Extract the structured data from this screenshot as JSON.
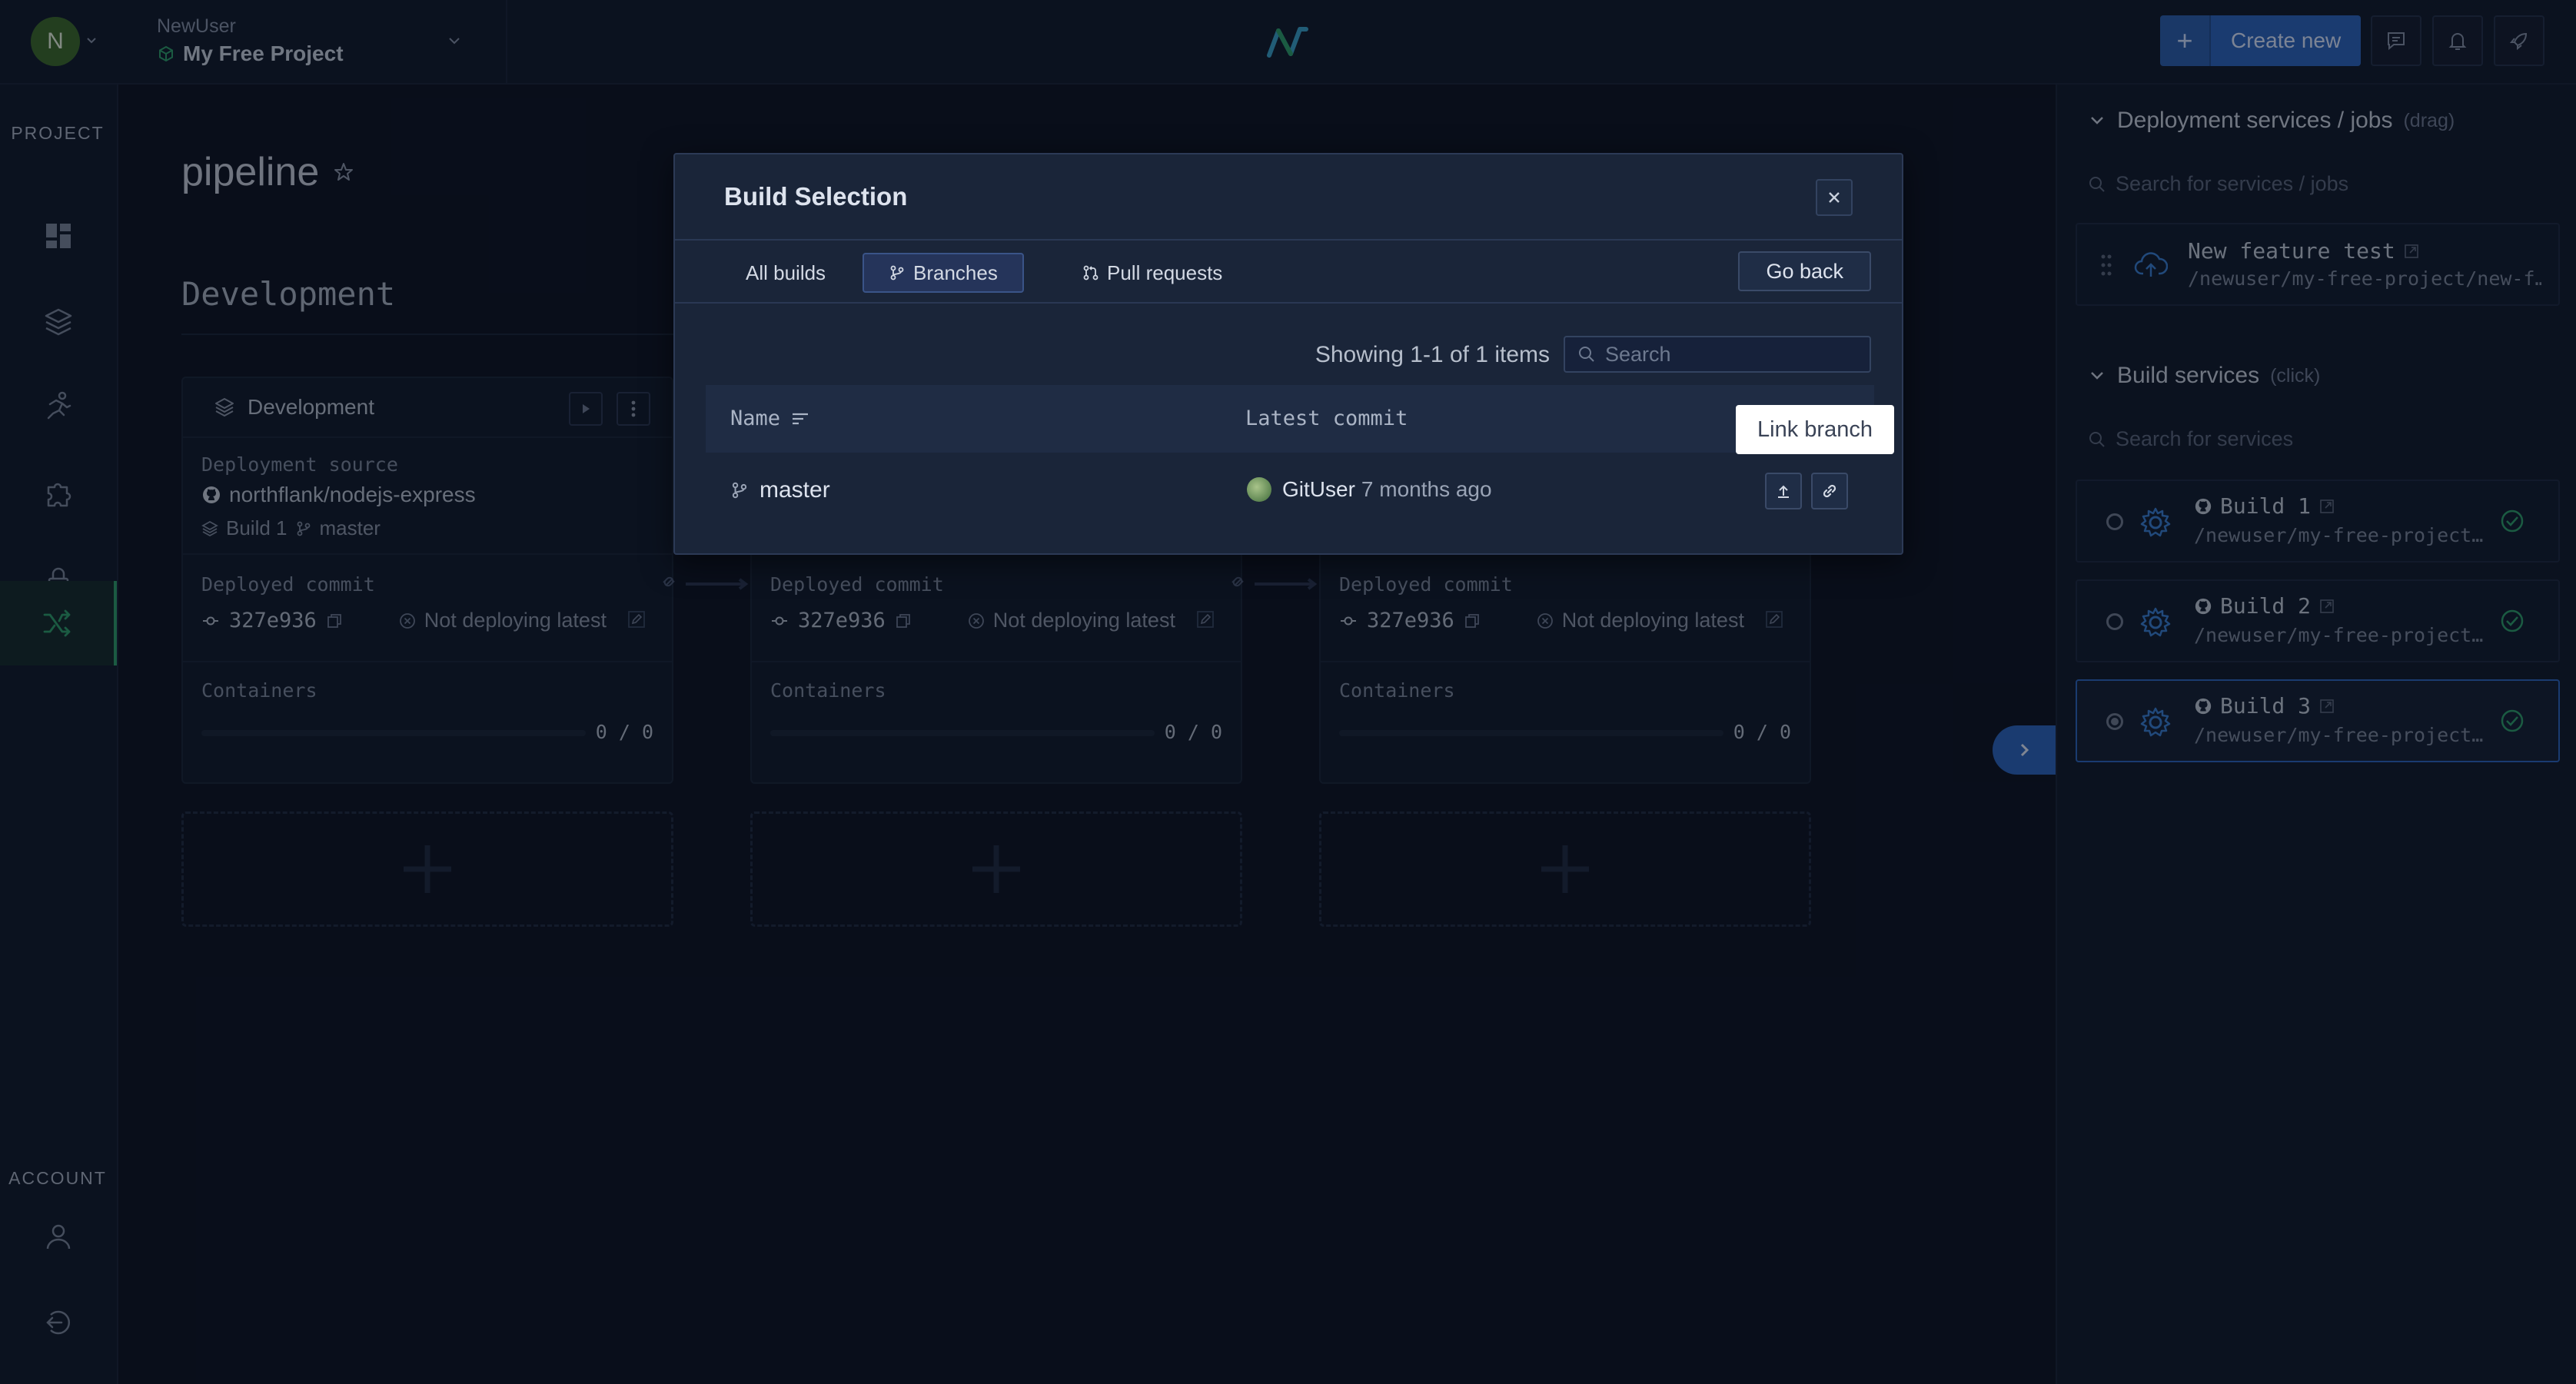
{
  "topbar": {
    "avatar_initial": "N",
    "project_user": "NewUser",
    "project_name": "My Free Project",
    "create_label": "Create new",
    "create_plus": "+"
  },
  "leftnav": {
    "project_heading": "PROJECT",
    "account_heading": "ACCOUNT",
    "items": [
      "dashboard-icon",
      "layers-icon",
      "runner-icon",
      "puzzle-icon",
      "lock-icon",
      "pipeline-icon"
    ],
    "active_item": "pipeline-icon"
  },
  "page": {
    "title": "pipeline",
    "stage_title": "Development"
  },
  "cards": [
    {
      "header": "Development",
      "source_label": "Deployment source",
      "repo": "northflank/nodejs-express",
      "build": "Build 1",
      "branch": "master",
      "commit_label": "Deployed commit",
      "commit": "327e936",
      "status": "Not deploying latest",
      "containers_label": "Containers",
      "containers_count": "0 / 0"
    },
    {
      "commit_label": "Deployed commit",
      "commit": "327e936",
      "status": "Not deploying latest",
      "containers_label": "Containers",
      "containers_count": "0 / 0"
    },
    {
      "commit_label": "Deployed commit",
      "commit": "327e936",
      "status": "Not deploying latest",
      "containers_label": "Containers",
      "containers_count": "0 / 0"
    }
  ],
  "rpanel": {
    "deploy_title": "Deployment services / jobs",
    "deploy_hint": "(drag)",
    "deploy_search_placeholder": "Search for services / jobs",
    "deploy_items": [
      {
        "name": "New feature test",
        "path": "/newuser/my-free-project/new-f…"
      }
    ],
    "build_title": "Build services",
    "build_hint": "(click)",
    "build_search_placeholder": "Search for services",
    "build_items": [
      {
        "name": "Build 1",
        "path": "/newuser/my-free-project…",
        "selected": false
      },
      {
        "name": "Build 2",
        "path": "/newuser/my-free-project…",
        "selected": false
      },
      {
        "name": "Build 3",
        "path": "/newuser/my-free-project…",
        "selected": true
      }
    ]
  },
  "modal": {
    "title": "Build Selection",
    "tabs": [
      "All builds",
      "Branches",
      "Pull requests"
    ],
    "active_tab": "Branches",
    "go_back": "Go back",
    "showing": "Showing 1-1 of 1 items",
    "search_placeholder": "Search",
    "columns": {
      "name": "Name",
      "latest_commit": "Latest commit"
    },
    "rows": [
      {
        "name": "master",
        "commit_user": "GitUser",
        "commit_age": "7 months ago"
      }
    ],
    "tooltip": "Link branch"
  },
  "colors": {
    "accent": "#2c65bd",
    "success": "#2e9e6a",
    "background": "#0d1322"
  }
}
